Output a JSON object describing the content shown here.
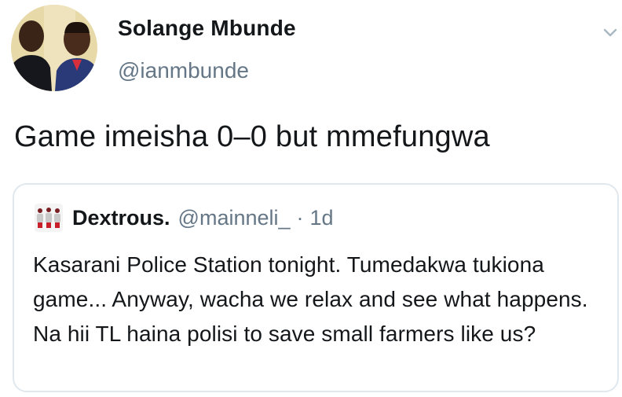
{
  "tweet": {
    "author": {
      "display_name": "Solange Mbunde",
      "handle": "@ianmbunde",
      "avatar_icon": "profile-photo-two-men"
    },
    "text": "Game imeisha 0–0 but mmefungwa",
    "menu_icon": "chevron-down-icon"
  },
  "quoted_tweet": {
    "author": {
      "display_name": "Dextrous.",
      "handle": "@mainneli_",
      "avatar_icon": "team-players-icon"
    },
    "separator": "·",
    "time": "1d",
    "text": "Kasarani Police Station tonight. Tumedakwa tukiona game... Anyway, wacha we relax and see what happens. Na hii TL haina polisi to save small farmers like us?"
  },
  "colors": {
    "primary_text": "#14171a",
    "secondary_text": "#657786",
    "card_border": "#e1e8ed"
  }
}
